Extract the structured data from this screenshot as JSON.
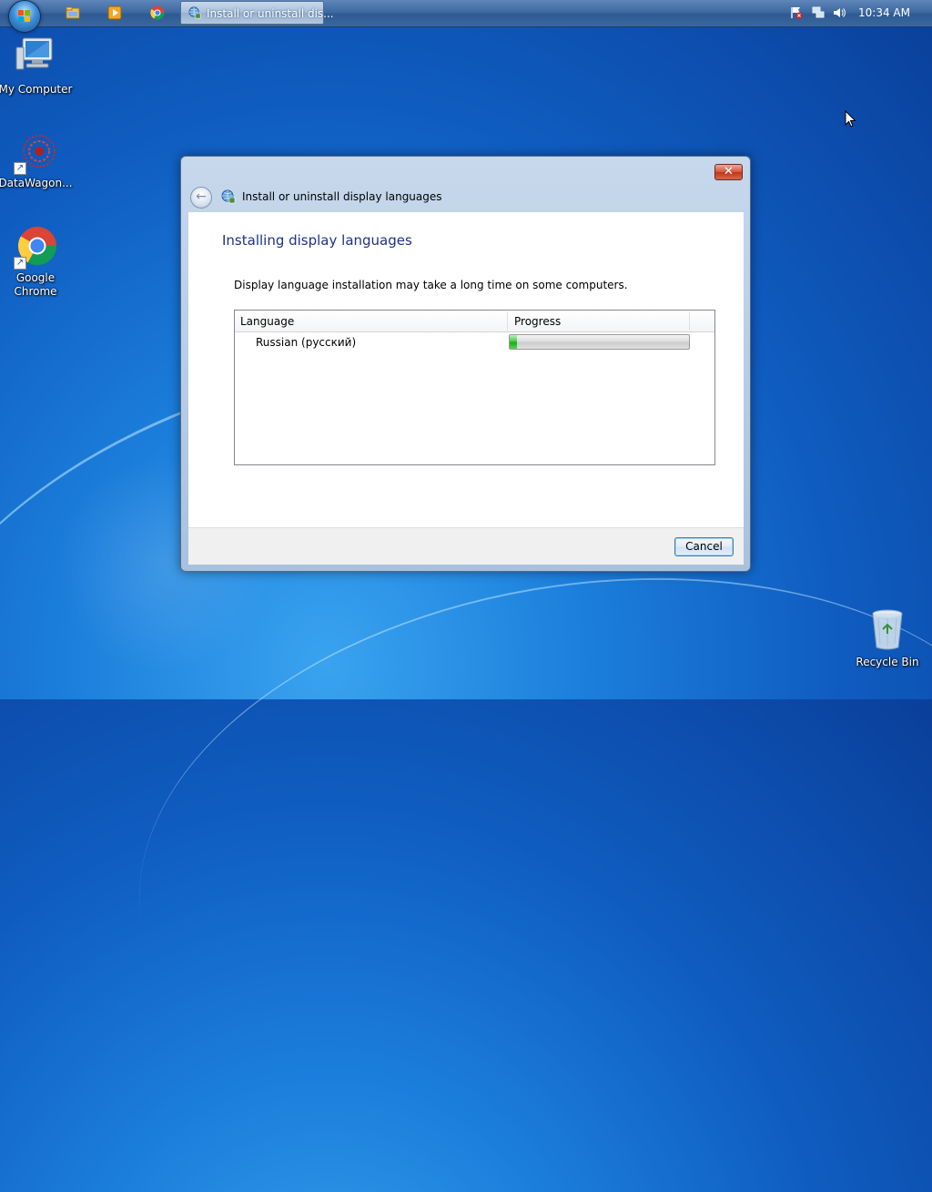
{
  "taskbar": {
    "start_button": "start-orb",
    "pinned": [
      "windows-explorer-icon",
      "media-player-icon",
      "chrome-icon"
    ],
    "active_task": {
      "label": "Install or uninstall dis...",
      "icon": "language-globe-icon"
    },
    "tray": [
      "action-center-flag-icon",
      "network-icon",
      "volume-icon"
    ],
    "clock": "10:34 AM"
  },
  "desktop": {
    "icons": [
      {
        "label": "My Computer",
        "icon": "computer-icon"
      },
      {
        "label": "DataWagon...",
        "icon": "datawagon-icon"
      },
      {
        "label": "Google Chrome",
        "icon": "chrome-icon"
      },
      {
        "label": "Recycle Bin",
        "icon": "recycle-bin-icon"
      }
    ]
  },
  "dialog": {
    "title": "Install or uninstall display languages",
    "close_label": "✕",
    "heading": "Installing display languages",
    "description": "Display language installation may take a long time on some computers.",
    "columns": [
      "Language",
      "Progress"
    ],
    "rows": [
      {
        "language": "Russian (русский)",
        "progress": 0.04
      }
    ],
    "cancel_label": "Cancel"
  },
  "colors": {
    "heading": "#1e3287",
    "progress_fill": "#18a918",
    "close_button": "#c23517"
  }
}
